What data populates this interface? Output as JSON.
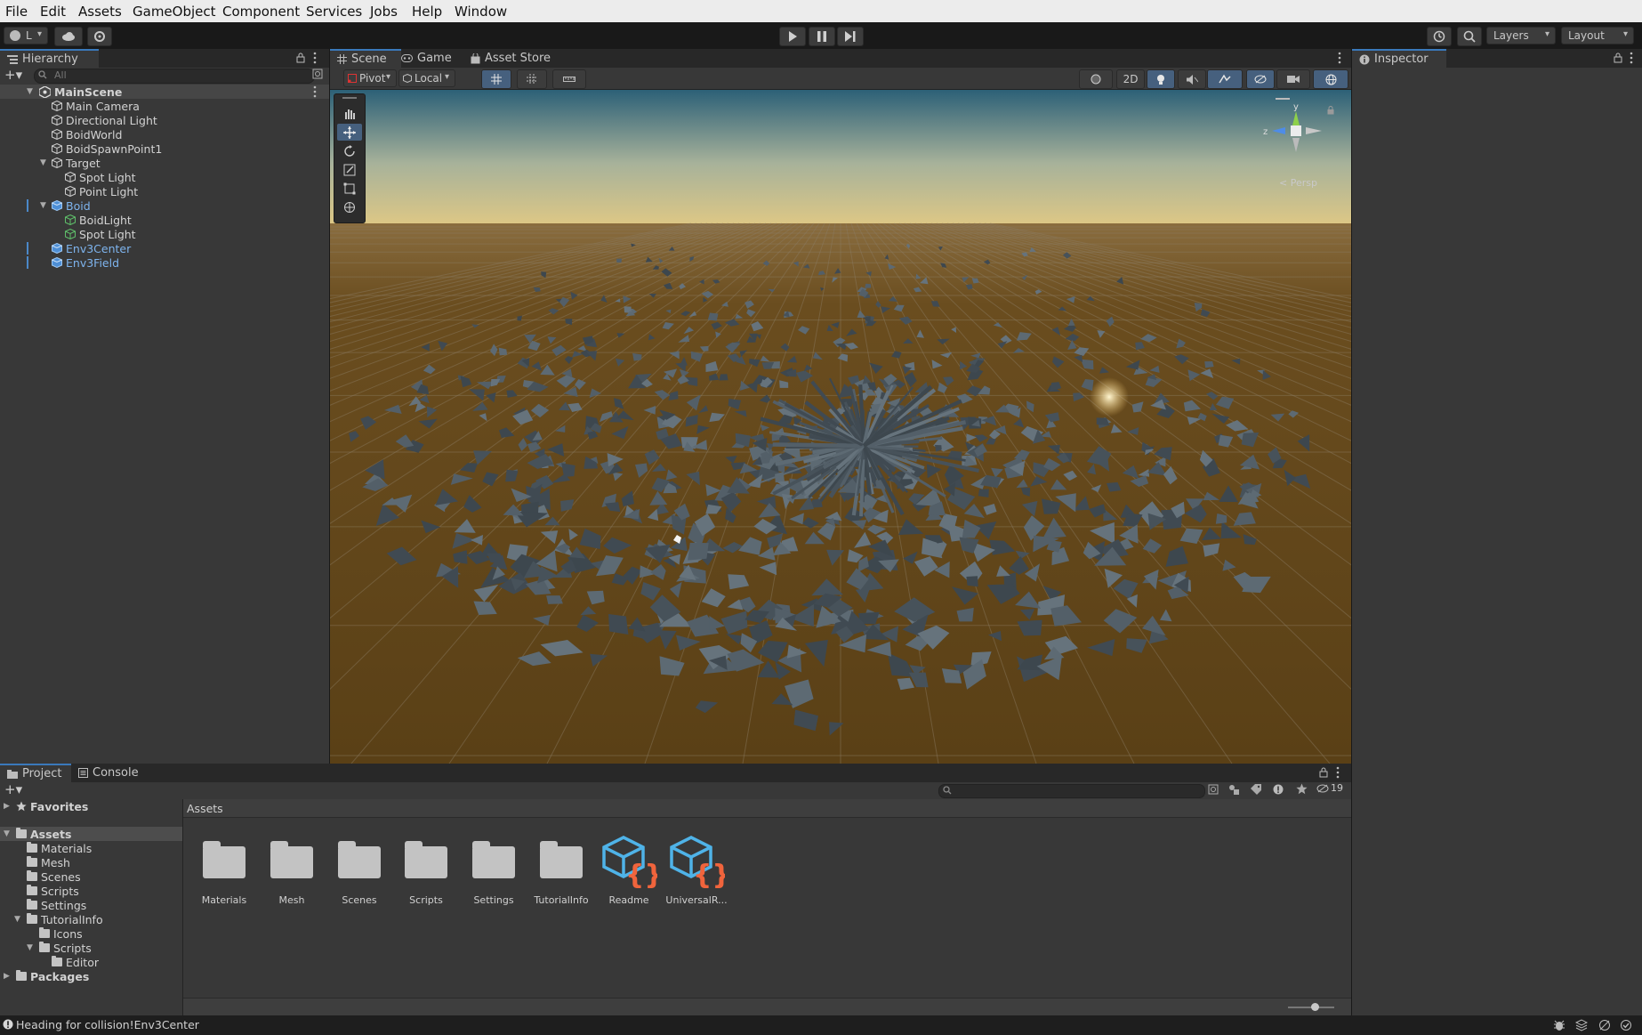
{
  "menu": [
    "File",
    "Edit",
    "Assets",
    "GameObject",
    "Component",
    "Services",
    "Jobs",
    "Help",
    "Window"
  ],
  "toolbar": {
    "account_label": "L",
    "layers_label": "Layers",
    "layout_label": "Layout"
  },
  "hierarchy": {
    "tab_label": "Hierarchy",
    "search_placeholder": "All",
    "scene_name": "MainScene",
    "items": [
      {
        "label": "Main Camera"
      },
      {
        "label": "Directional Light"
      },
      {
        "label": "BoidWorld"
      },
      {
        "label": "BoidSpawnPoint1"
      },
      {
        "label": "Target"
      },
      {
        "label": "Spot Light"
      },
      {
        "label": "Point Light"
      },
      {
        "label": "Boid"
      },
      {
        "label": "BoidLight"
      },
      {
        "label": "Spot Light"
      },
      {
        "label": "Env3Center"
      },
      {
        "label": "Env3Field"
      }
    ]
  },
  "scene_tabs": [
    "Scene",
    "Game",
    "Asset Store"
  ],
  "scene_toolbar": {
    "pivot_label": "Pivot",
    "local_label": "Local",
    "mode_2d_label": "2D",
    "persp_label": "< Persp"
  },
  "inspector": {
    "tab_label": "Inspector"
  },
  "bottom_tabs": [
    "Project",
    "Console"
  ],
  "project": {
    "hidden_count": "19",
    "breadcrumb": "Assets",
    "tree": [
      {
        "label": "Favorites"
      },
      {
        "label": "Assets"
      },
      {
        "label": "Materials"
      },
      {
        "label": "Mesh"
      },
      {
        "label": "Scenes"
      },
      {
        "label": "Scripts"
      },
      {
        "label": "Settings"
      },
      {
        "label": "TutorialInfo"
      },
      {
        "label": "Icons"
      },
      {
        "label": "Scripts"
      },
      {
        "label": "Editor"
      },
      {
        "label": "Packages"
      }
    ],
    "assets": [
      {
        "label": "Materials",
        "icon": "folder-icon"
      },
      {
        "label": "Mesh",
        "icon": "folder-icon"
      },
      {
        "label": "Scenes",
        "icon": "folder-icon"
      },
      {
        "label": "Scripts",
        "icon": "folder-icon"
      },
      {
        "label": "Settings",
        "icon": "folder-icon"
      },
      {
        "label": "TutorialInfo",
        "icon": "folder-icon"
      },
      {
        "label": "Readme",
        "icon": "scriptable-object-icon"
      },
      {
        "label": "UniversalR...",
        "icon": "scriptable-object-icon"
      }
    ]
  },
  "status": {
    "message": "Heading for collision!Env3Center"
  },
  "colors": {
    "accent": "#3a79bb",
    "selected_blue": "#7eb4ee",
    "panel": "#383838",
    "ground": "#5a4118",
    "sky": "#d0c68a"
  }
}
